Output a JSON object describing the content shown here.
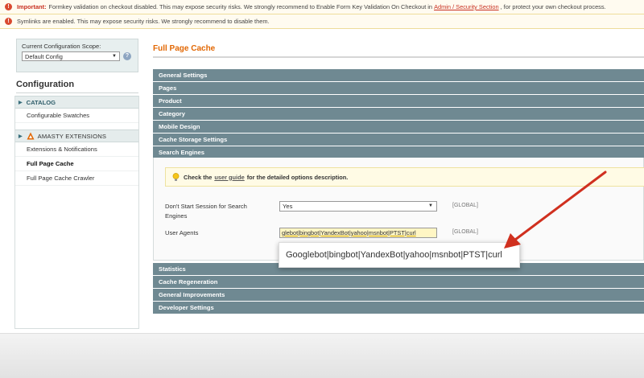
{
  "notices": {
    "formkey": {
      "important": "Important:",
      "text_before": "Formkey validation on checkout disabled. This may expose security risks. We strongly recommend to Enable Form Key Validation On Checkout in",
      "link": "Admin / Security Section",
      "text_after": ", for protect your own checkout process."
    },
    "symlinks": {
      "text": "Symlinks are enabled. This may expose security risks. We strongly recommend to disable them."
    }
  },
  "scope": {
    "label": "Current Configuration Scope:",
    "selected": "Default Config"
  },
  "sidebar": {
    "title": "Configuration",
    "catalog": {
      "label": "CATALOG",
      "items": [
        {
          "label": "Configurable Swatches"
        }
      ]
    },
    "amasty": {
      "label": "AMASTY EXTENSIONS",
      "items": [
        {
          "label": "Extensions & Notifications"
        },
        {
          "label": "Full Page Cache"
        },
        {
          "label": "Full Page Cache Crawler"
        }
      ]
    }
  },
  "main": {
    "title": "Full Page Cache",
    "sections_top": [
      {
        "label": "General Settings"
      },
      {
        "label": "Pages"
      },
      {
        "label": "Product"
      },
      {
        "label": "Category"
      },
      {
        "label": "Mobile Design"
      },
      {
        "label": "Cache Storage Settings"
      },
      {
        "label": "Search Engines"
      }
    ],
    "search_engines": {
      "tip_before": "Check the",
      "tip_link": "user guide",
      "tip_after": "for the detailed options description.",
      "fields": {
        "dont_start": {
          "label": "Don't Start Session for Search Engines",
          "value": "Yes",
          "scope": "[GLOBAL]"
        },
        "user_agents": {
          "label": "User Agents",
          "value": "glebot|bingbot|YandexBot|yahoo|msnbot|PTST|curl",
          "scope": "[GLOBAL]"
        }
      }
    },
    "callout": "Googlebot|bingbot|YandexBot|yahoo|msnbot|PTST|curl",
    "sections_bottom": [
      {
        "label": "Statistics"
      },
      {
        "label": "Cache Regeneration"
      },
      {
        "label": "General Improvements"
      },
      {
        "label": "Developer Settings"
      }
    ]
  },
  "colors": {
    "accent_orange": "#e26703",
    "section_header": "#6f8992",
    "arrow_red": "#d0301f"
  }
}
